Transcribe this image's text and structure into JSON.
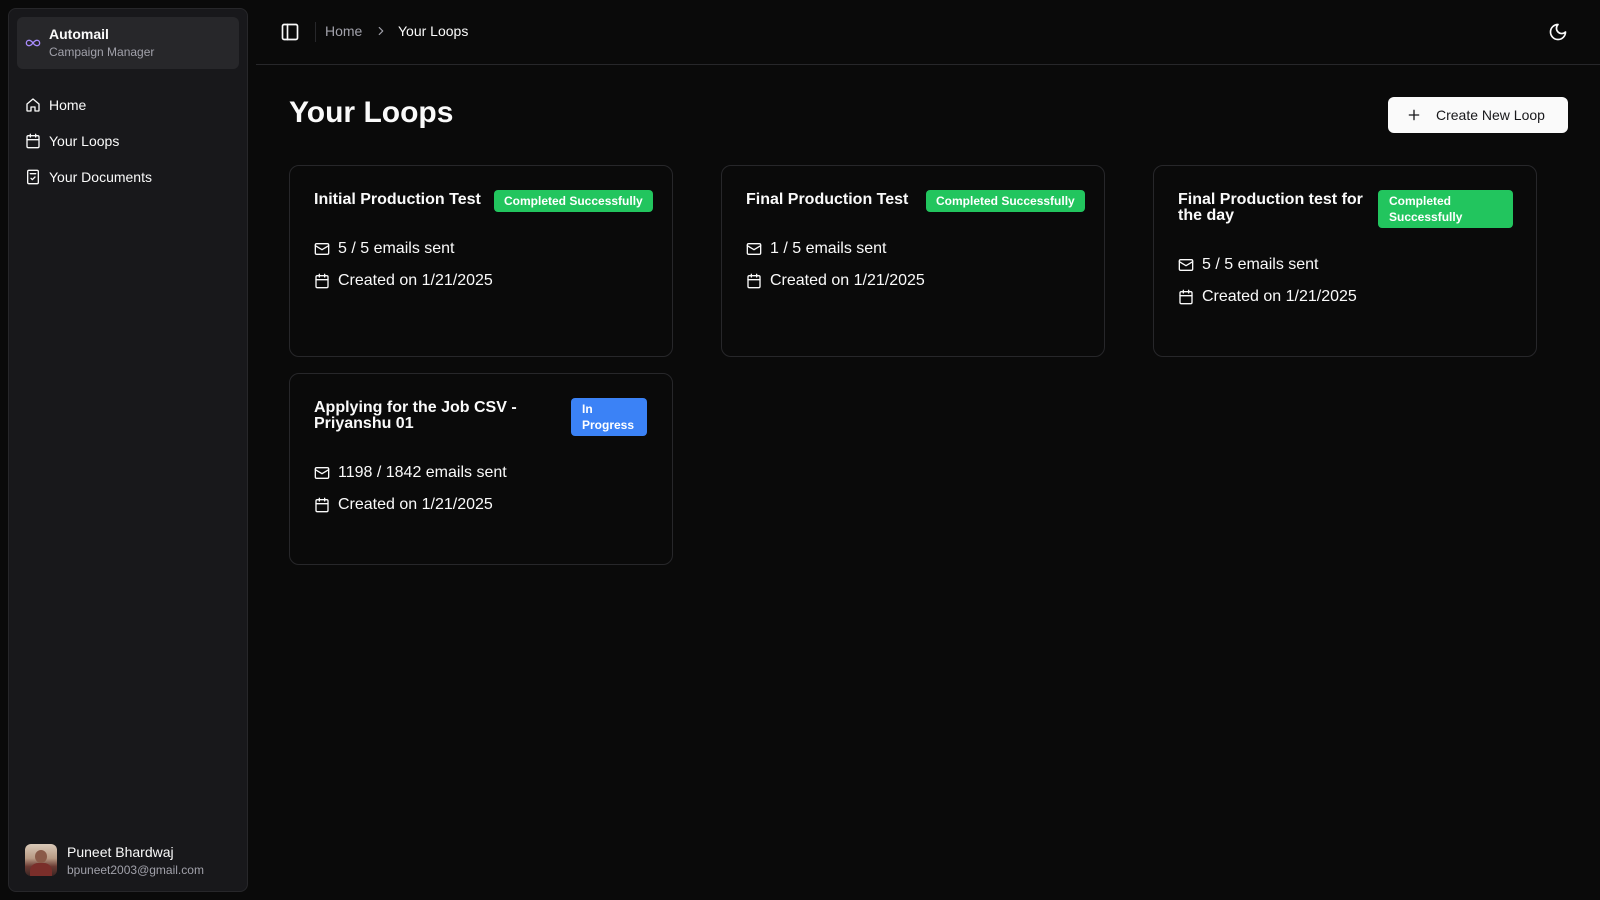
{
  "sidebar": {
    "brand": {
      "name": "Automail",
      "subtitle": "Campaign Manager"
    },
    "items": [
      {
        "label": "Home",
        "icon": "home-icon"
      },
      {
        "label": "Your Loops",
        "icon": "calendar-icon"
      },
      {
        "label": "Your Documents",
        "icon": "document-check-icon"
      }
    ],
    "user": {
      "name": "Puneet Bhardwaj",
      "email": "bpuneet2003@gmail.com"
    }
  },
  "header": {
    "breadcrumb": {
      "home": "Home",
      "current": "Your Loops"
    }
  },
  "main": {
    "title": "Your Loops",
    "create_label": "Create New Loop",
    "loops": [
      {
        "title": "Initial Production Test",
        "status": "Completed Successfully",
        "emails": "5 / 5 emails sent",
        "created": "Created on 1/21/2025"
      },
      {
        "title": "Final Production Test",
        "status": "Completed Successfully",
        "emails": "1 / 5 emails sent",
        "created": "Created on 1/21/2025"
      },
      {
        "title": "Final Production test for the day",
        "status": "Completed Successfully",
        "emails": "5 / 5 emails sent",
        "created": "Created on 1/21/2025"
      },
      {
        "title": "Applying for the Job CSV - Priyanshu 01",
        "status": "In Progress",
        "emails": "1198 / 1842 emails sent",
        "created": "Created on 1/21/2025"
      }
    ]
  },
  "colors": {
    "background": "#0a0a0a",
    "sidebar": "#18181b",
    "border": "#27272a",
    "success": "#22c55e",
    "progress": "#3b82f6",
    "brand_icon": "#a78bfa"
  }
}
